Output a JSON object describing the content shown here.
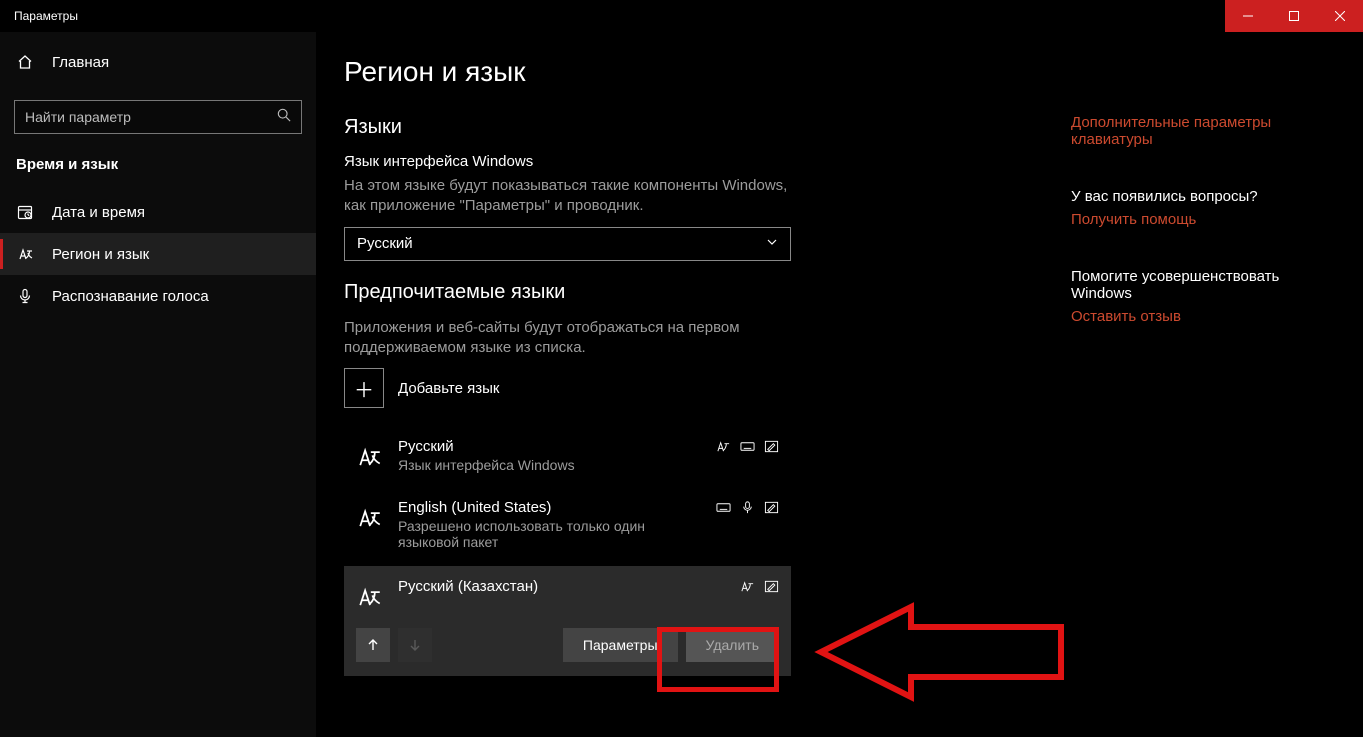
{
  "window": {
    "title": "Параметры"
  },
  "sidebar": {
    "home": "Главная",
    "search_placeholder": "Найти параметр",
    "group": "Время и язык",
    "items": [
      {
        "label": "Дата и время"
      },
      {
        "label": "Регион и язык"
      },
      {
        "label": "Распознавание голоса"
      }
    ]
  },
  "page": {
    "title": "Регион и язык",
    "languages_heading": "Языки",
    "ui_lang_label": "Язык интерфейса Windows",
    "ui_lang_desc": "На этом языке будут показываться такие компоненты Windows, как приложение \"Параметры\" и проводник.",
    "ui_lang_value": "Русский",
    "preferred_heading": "Предпочитаемые языки",
    "preferred_desc": "Приложения и веб-сайты будут отображаться на первом поддерживаемом языке из списка.",
    "add_language": "Добавьте язык",
    "langs": [
      {
        "name": "Русский",
        "sub": "Язык интерфейса Windows"
      },
      {
        "name": "English (United States)",
        "sub": "Разрешено использовать только один языковой пакет"
      },
      {
        "name": "Русский (Казахстан)",
        "sub": ""
      }
    ],
    "btn_options": "Параметры",
    "btn_remove": "Удалить"
  },
  "right": {
    "kb_link": "Дополнительные параметры клавиатуры",
    "q1": "У вас появились вопросы?",
    "help": "Получить помощь",
    "q2": "Помогите усовершенствовать Windows",
    "feedback": "Оставить отзыв"
  }
}
